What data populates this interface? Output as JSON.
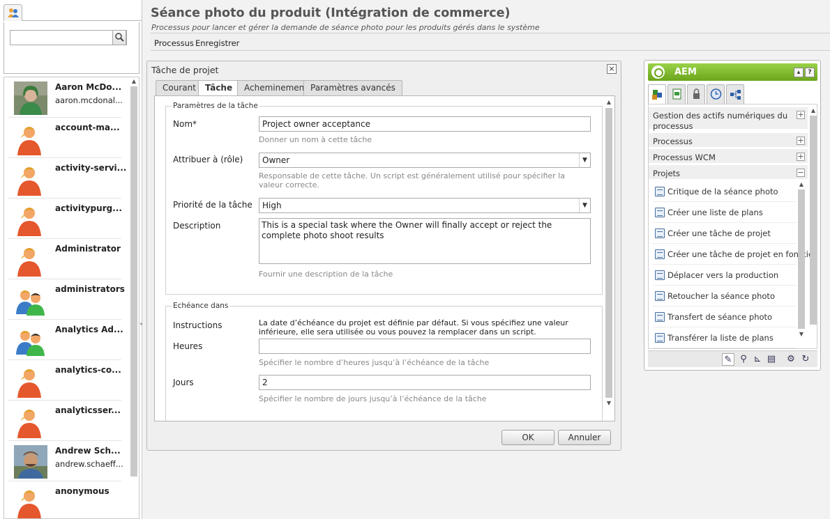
{
  "left_panel": {
    "search": {
      "placeholder": "",
      "value": ""
    },
    "users": [
      {
        "name": "Aaron McDo...",
        "email": "aaron.mcdonal...",
        "avatar": "photo-woman"
      },
      {
        "name": "account-ma...",
        "email": "",
        "avatar": "default-user"
      },
      {
        "name": "activity-servi...",
        "email": "",
        "avatar": "default-user"
      },
      {
        "name": "activitypurg...",
        "email": "",
        "avatar": "default-user"
      },
      {
        "name": "Administrator",
        "email": "",
        "avatar": "default-user"
      },
      {
        "name": "administrators",
        "email": "",
        "avatar": "group"
      },
      {
        "name": "Analytics Ad...",
        "email": "",
        "avatar": "group"
      },
      {
        "name": "analytics-co...",
        "email": "",
        "avatar": "default-user"
      },
      {
        "name": "analyticsser...",
        "email": "",
        "avatar": "default-user"
      },
      {
        "name": "Andrew Sch...",
        "email": "andrew.schaeff...",
        "avatar": "photo-man"
      },
      {
        "name": "anonymous",
        "email": "",
        "avatar": "default-user"
      }
    ]
  },
  "header": {
    "title": "Séance photo du produit (Intégration de commerce)",
    "subtitle": "Processus pour lancer et gérer la demande de séance photo pour les produits gérés dans le système",
    "toolbar": {
      "processus": "Processus",
      "enregistrer": "Enregistrer"
    }
  },
  "dialog": {
    "title": "Tâche de projet",
    "close": "×",
    "tabs": [
      "Courant",
      "Tâche",
      "Acheminement",
      "Paramètres avancés"
    ],
    "active_tab": "Tâche",
    "task_params": {
      "legend": "Paramètres de la tâche",
      "name_label": "Nom*",
      "name_value": "Project owner acceptance",
      "name_hint": "Donner un nom à cette tâche",
      "assign_label": "Attribuer à (rôle)",
      "assign_value": "Owner",
      "assign_hint": "Responsable de cette tâche. Un script est généralement utilisé pour spécifier la valeur correcte.",
      "priority_label": "Priorité de la tâche",
      "priority_value": "High",
      "description_label": "Description",
      "description_value": "This is a special task where the Owner will finally accept or reject the complete photo shoot results",
      "description_hint": "Fournir une description de la tâche"
    },
    "due": {
      "legend": "Echéance dans",
      "instructions_label": "Instructions",
      "instructions_text": "La date d’échéance du projet est définie par défaut. Si vous spécifiez une valeur inférieure, elle sera utilisée ou vous pouvez la remplacer dans un script.",
      "hours_label": "Heures",
      "hours_value": "",
      "hours_hint": "Spécifier le nombre d’heures jusqu’à l’échéance de la tâche",
      "days_label": "Jours",
      "days_value": "2",
      "days_hint": "Spécifier le nombre de jours jusqu’à l’échéance de la tâche"
    },
    "ok": "OK",
    "cancel": "Annuler"
  },
  "sidekick": {
    "title": "AEM",
    "collapse": "▴",
    "help": "?",
    "tabs": [
      "components-icon",
      "page-icon",
      "lock-icon",
      "versioning-icon",
      "workflow-icon"
    ],
    "categories": [
      {
        "label": "Gestion des actifs numériques du processus",
        "state": "+"
      },
      {
        "label": "Processus",
        "state": "+"
      },
      {
        "label": "Processus WCM",
        "state": "+"
      },
      {
        "label": "Projets",
        "state": "−"
      }
    ],
    "components": [
      "Critique de la séance photo",
      "Créer une liste de plans",
      "Créer une tâche de projet",
      "Créer une tâche de projet en fonction",
      "Déplacer vers la production",
      "Retoucher la séance photo",
      "Transfert de séance photo",
      "Transférer la liste de plans"
    ],
    "footer_icons": [
      "edit-icon",
      "zoom-icon",
      "ruler-icon",
      "page-properties-icon",
      "settings-icon",
      "refresh-icon"
    ],
    "accent_color": "#7cb82f"
  }
}
